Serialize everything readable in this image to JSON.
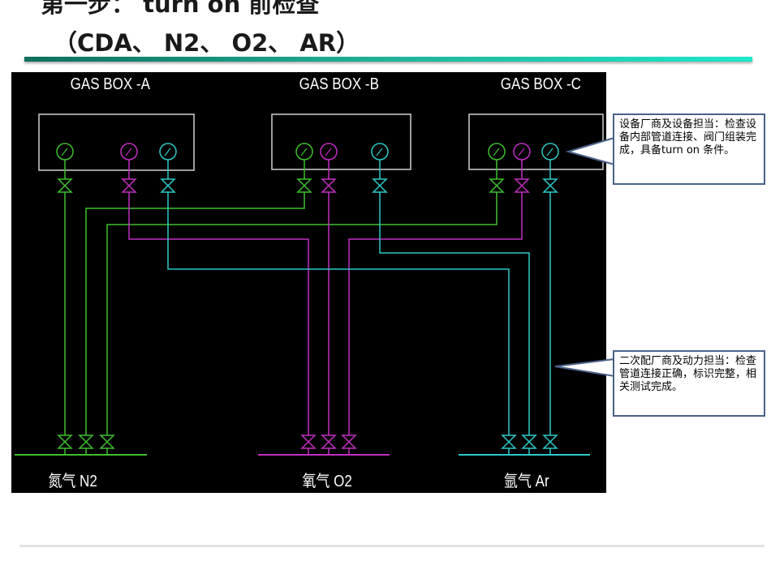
{
  "title": {
    "line1": "第一步： turn on 前检查",
    "line2": "（CDA、 N2、 O2、 AR）"
  },
  "diagram": {
    "boxes": [
      "GAS BOX -A",
      "GAS BOX -B",
      "GAS BOX -C"
    ],
    "gases": [
      "氮气 N2",
      "氧气 O2",
      "氩气 Ar"
    ],
    "colors": {
      "n2": "#3fbf2f",
      "o2": "#c02fc0",
      "ar": "#2fc8c8"
    }
  },
  "callouts": [
    {
      "text": "设备厂商及设备担当：检查设备内部管道连接、阀门组装完成，具备turn on 条件。"
    },
    {
      "text": "二次配厂商及动力担当：检查管道连接正确，标识完整，相关测试完成。"
    }
  ]
}
